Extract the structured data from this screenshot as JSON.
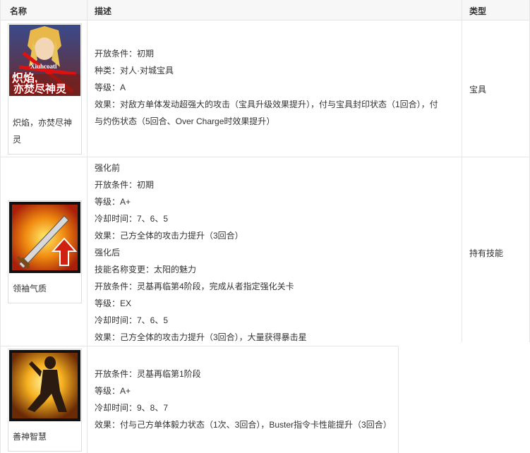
{
  "header": {
    "col_name": "名称",
    "col_desc": "描述",
    "col_type": "类型"
  },
  "rows": [
    {
      "name": "炽焰，亦焚尽神灵",
      "img_text_small": "Xiuhcoatl",
      "img_text_big_1": "炽焰,",
      "img_text_big_2": "亦焚尽神灵",
      "lines": [
        "开放条件：初期",
        "种类：对人·对城宝具",
        "等级：A",
        "效果：对敌方单体发动超强大的攻击（宝具升级效果提升），付与宝具封印状态（1回合），付",
        "与灼伤状态（5回合、Over Charge时效果提升）"
      ],
      "type": "宝具"
    },
    {
      "name": "领袖气质",
      "lines": [
        "强化前",
        "开放条件：初期",
        "等级：A+",
        "冷却时间：7、6、5",
        "效果：己方全体的攻击力提升（3回合）",
        "强化后",
        "技能名称变更：太阳的魅力",
        "开放条件：灵基再临第4阶段，完成从者指定强化关卡",
        "等级：EX",
        "冷却时间：7、6、5",
        "效果：己方全体的攻击力提升（3回合），大量获得暴击星"
      ],
      "type": "持有技能"
    },
    {
      "name": "善神智慧",
      "lines": [
        "开放条件：灵基再临第1阶段",
        "等级：A+",
        "冷却时间：9、8、7",
        "效果：付与己方单体毅力状态（1次、3回合），Buster指令卡性能提升（3回合）"
      ]
    }
  ]
}
